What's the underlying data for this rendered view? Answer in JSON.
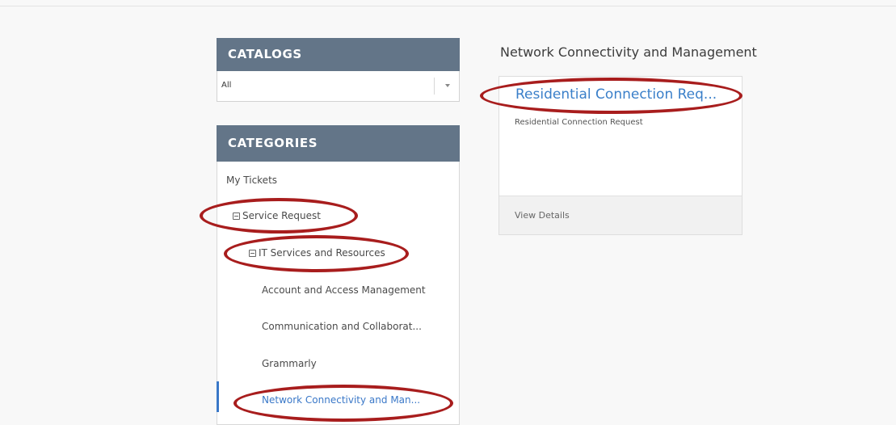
{
  "catalogs": {
    "header": "CATALOGS",
    "selected": "All"
  },
  "categories": {
    "header": "CATEGORIES",
    "items": [
      {
        "label": "My Tickets"
      },
      {
        "label": "Service Request"
      },
      {
        "label": "IT Services and Resources"
      },
      {
        "label": "Account and Access Management"
      },
      {
        "label": "Communication and Collaborat..."
      },
      {
        "label": "Grammarly"
      },
      {
        "label": "Network Connectivity and Man..."
      }
    ]
  },
  "main": {
    "section_title": "Network Connectivity and Management",
    "card": {
      "title": "Residential Connection Req...",
      "description": "Residential Connection Request",
      "footer_link": "View Details"
    }
  },
  "colors": {
    "header_bg": "#637588",
    "accent": "#3a78c8",
    "annotation": "#a81d1d"
  }
}
